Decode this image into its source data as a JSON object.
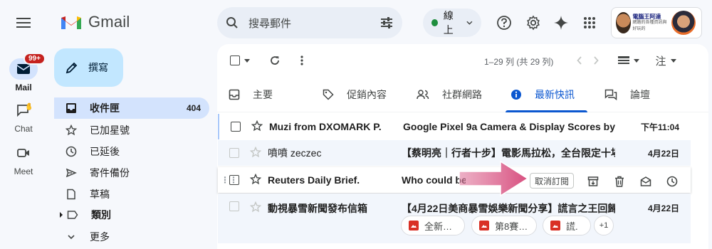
{
  "app": {
    "name": "Gmail"
  },
  "rail": {
    "mail_label": "Mail",
    "mail_badge": "99+",
    "chat_label": "Chat",
    "meet_label": "Meet"
  },
  "search": {
    "placeholder": "搜尋郵件"
  },
  "status": {
    "label": "線上",
    "color": "#1e8e3e"
  },
  "profile": {
    "brand_text_1": "電腦王阿達",
    "brand_text_2": "網路的各種資訊與好玩的"
  },
  "compose": {
    "label": "撰寫"
  },
  "nav": [
    {
      "label": "收件匣",
      "count": "404",
      "icon": "inbox-icon"
    },
    {
      "label": "已加星號",
      "icon": "star-icon"
    },
    {
      "label": "已延後",
      "icon": "clock-icon"
    },
    {
      "label": "寄件備份",
      "icon": "send-icon"
    },
    {
      "label": "草稿",
      "icon": "file-icon"
    },
    {
      "label": "類別",
      "icon": "label-icon"
    },
    {
      "label": "更多",
      "icon": "chevron-down-icon"
    }
  ],
  "toolbar": {
    "pager": "1–29 列 (共 29 列)",
    "view_label": "注"
  },
  "tabs": [
    {
      "label": "主要",
      "icon": "inbox-icon"
    },
    {
      "label": "促銷內容",
      "icon": "tag-icon"
    },
    {
      "label": "社群網路",
      "icon": "people-icon"
    },
    {
      "label": "最新快訊",
      "icon": "info-icon"
    },
    {
      "label": "論壇",
      "icon": "forum-icon"
    }
  ],
  "emails": [
    {
      "sender": "Muzi from DXOMARK P.",
      "subject": "Google Pixel 9a Camera & Display Scores by …",
      "date": "下午11:04"
    },
    {
      "sender": "噴噴 zeczec",
      "subject": "【蔡明亮｜行者十步】電影馬拉松，全台限定十場…",
      "date": "4月22日"
    },
    {
      "sender": "Reuters Daily Brief.",
      "subject": "Who could be",
      "date": ""
    },
    {
      "sender": "動視暴雪新聞發布信箱",
      "subject": "【4月22日美商暴雪娛樂新聞分享】謊言之王回歸…",
      "date": "4月22日"
    }
  ],
  "row_actions": {
    "unsubscribe": "取消訂閱"
  },
  "attachments": [
    {
      "label": "全新…"
    },
    {
      "label": "第8賽…"
    },
    {
      "label": "謊."
    },
    {
      "label": "+1"
    }
  ],
  "colors": {
    "accent": "#0b57d0",
    "arrow": "#d84f7f"
  }
}
